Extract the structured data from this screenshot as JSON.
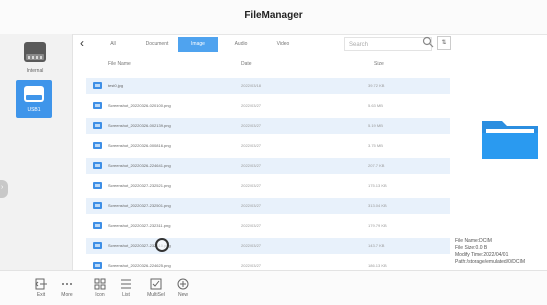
{
  "window": {
    "title": "FileManager"
  },
  "sidebar": {
    "items": [
      {
        "label": "Internal",
        "icon": "hard-drive-icon"
      },
      {
        "label": "USB1",
        "icon": "usb-drive-icon",
        "selected": true
      }
    ]
  },
  "tabs": [
    {
      "label": "All"
    },
    {
      "label": "Document"
    },
    {
      "label": "Image",
      "active": true
    },
    {
      "label": "Audio"
    },
    {
      "label": "Video"
    }
  ],
  "search": {
    "placeholder": "Search"
  },
  "columns": {
    "name": "File Name",
    "date": "Date",
    "size": "Size"
  },
  "files": [
    {
      "name": "test0.jpg",
      "date": "2022/03/18",
      "size": "39.72 KB"
    },
    {
      "name": "Screenshot_20220326-020100.png",
      "date": "2022/03/27",
      "size": "5.63 MB"
    },
    {
      "name": "Screenshot_20220326-002139.png",
      "date": "2022/03/27",
      "size": "5.19 MB"
    },
    {
      "name": "Screenshot_20220326-000816.png",
      "date": "2022/03/27",
      "size": "3.75 MB"
    },
    {
      "name": "Screenshot_20220326-224641.png",
      "date": "2022/03/27",
      "size": "207.7 KB"
    },
    {
      "name": "Screenshot_20220327-232521.png",
      "date": "2022/03/27",
      "size": "175.13 KB"
    },
    {
      "name": "Screenshot_20220327-232501.png",
      "date": "2022/03/27",
      "size": "313.04 KB"
    },
    {
      "name": "Screenshot_20220327-232311.png",
      "date": "2022/03/27",
      "size": "179.79 KB"
    },
    {
      "name": "Screenshot_20220327-232510.png",
      "date": "2022/03/27",
      "size": "143.7 KB"
    },
    {
      "name": "Screenshot_20220326-224625.png",
      "date": "2022/03/27",
      "size": "186.13 KB"
    }
  ],
  "info": {
    "name": "File Name:DCIM",
    "size": "File Size:0.0 B",
    "modified": "Modify Time:2022/04/01",
    "path": "Path:/storage/emulated/0/DCIM"
  },
  "toolbar": {
    "exit": "Exit",
    "more": "More",
    "icon": "Icon",
    "list": "List",
    "multisel": "MultiSel",
    "new": "New"
  },
  "colors": {
    "accent": "#4fa3ef",
    "row_shade": "#e8f1fb",
    "file_icon": "#3e8fe6"
  }
}
